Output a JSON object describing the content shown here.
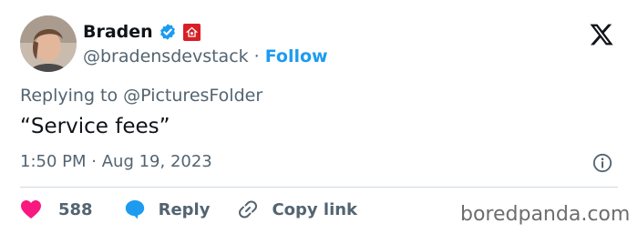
{
  "author": {
    "name": "Braden",
    "handle": "@bradensdevstack",
    "follow_label": "Follow",
    "separator": "·",
    "verified_icon": "verified-badge-icon",
    "affiliation_icon": "affiliation-badge-icon"
  },
  "tweet": {
    "replying_prefix": "Replying to",
    "replying_to": "@PicturesFolder",
    "text": "“Service fees”",
    "time": "1:50 PM",
    "date": "Aug 19, 2023",
    "separator": "·"
  },
  "actions": {
    "likes_count": "588",
    "reply_label": "Reply",
    "copy_link_label": "Copy link"
  },
  "watermark": "boredpanda.com",
  "colors": {
    "accent": "#1d9bf0",
    "like": "#f91880",
    "affiliation": "#d81f26",
    "text": "#0f1419",
    "secondary": "#536471"
  }
}
